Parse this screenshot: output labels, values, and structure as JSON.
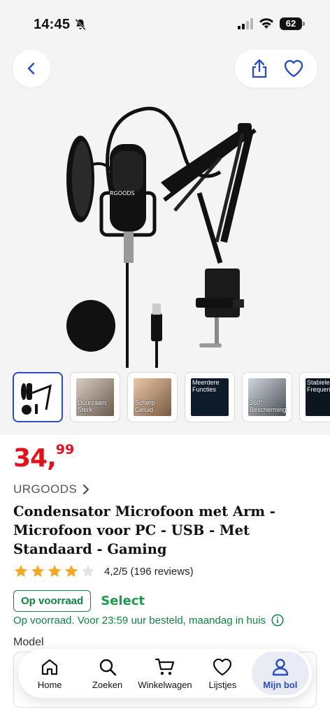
{
  "status_bar": {
    "time": "14:45",
    "battery": "62"
  },
  "thumbnails": [
    {
      "caption": "",
      "active": true
    },
    {
      "caption": "Duurzaam",
      "caption2": "Sterk"
    },
    {
      "caption": "Scherp",
      "caption2": "Geluid"
    },
    {
      "caption": "Meerdere",
      "caption2": "Functies"
    },
    {
      "caption": "360°",
      "caption2": "Bescherming"
    },
    {
      "caption": "Stabiele",
      "caption2": "Frequentie"
    }
  ],
  "product": {
    "price_int": "34,",
    "price_dec": "99",
    "brand": "URGOODS",
    "title": "Condensator Microfoon met Arm - Microfoon voor PC - USB - Met Standaard - Gaming",
    "rating_text": "4,2/5 (196 reviews)",
    "rating_value": 4.2,
    "stock_badge": "Op voorraad",
    "select_label": "Select",
    "delivery_text": "Op voorraad. Voor 23:59 uur besteld, maandag in huis",
    "model_label": "Model"
  },
  "tabbar": {
    "items": [
      {
        "label": "Home",
        "icon": "home-icon"
      },
      {
        "label": "Zoeken",
        "icon": "search-icon"
      },
      {
        "label": "Winkelwagen",
        "icon": "cart-icon"
      },
      {
        "label": "Lijstjes",
        "icon": "heart-icon"
      },
      {
        "label": "Mijn bol",
        "icon": "user-icon",
        "active": true
      }
    ]
  },
  "colors": {
    "price": "#e1141e",
    "accent": "#2a4dbd",
    "stock": "#118242",
    "select": "#1b9c4c",
    "star": "#f5a623"
  }
}
